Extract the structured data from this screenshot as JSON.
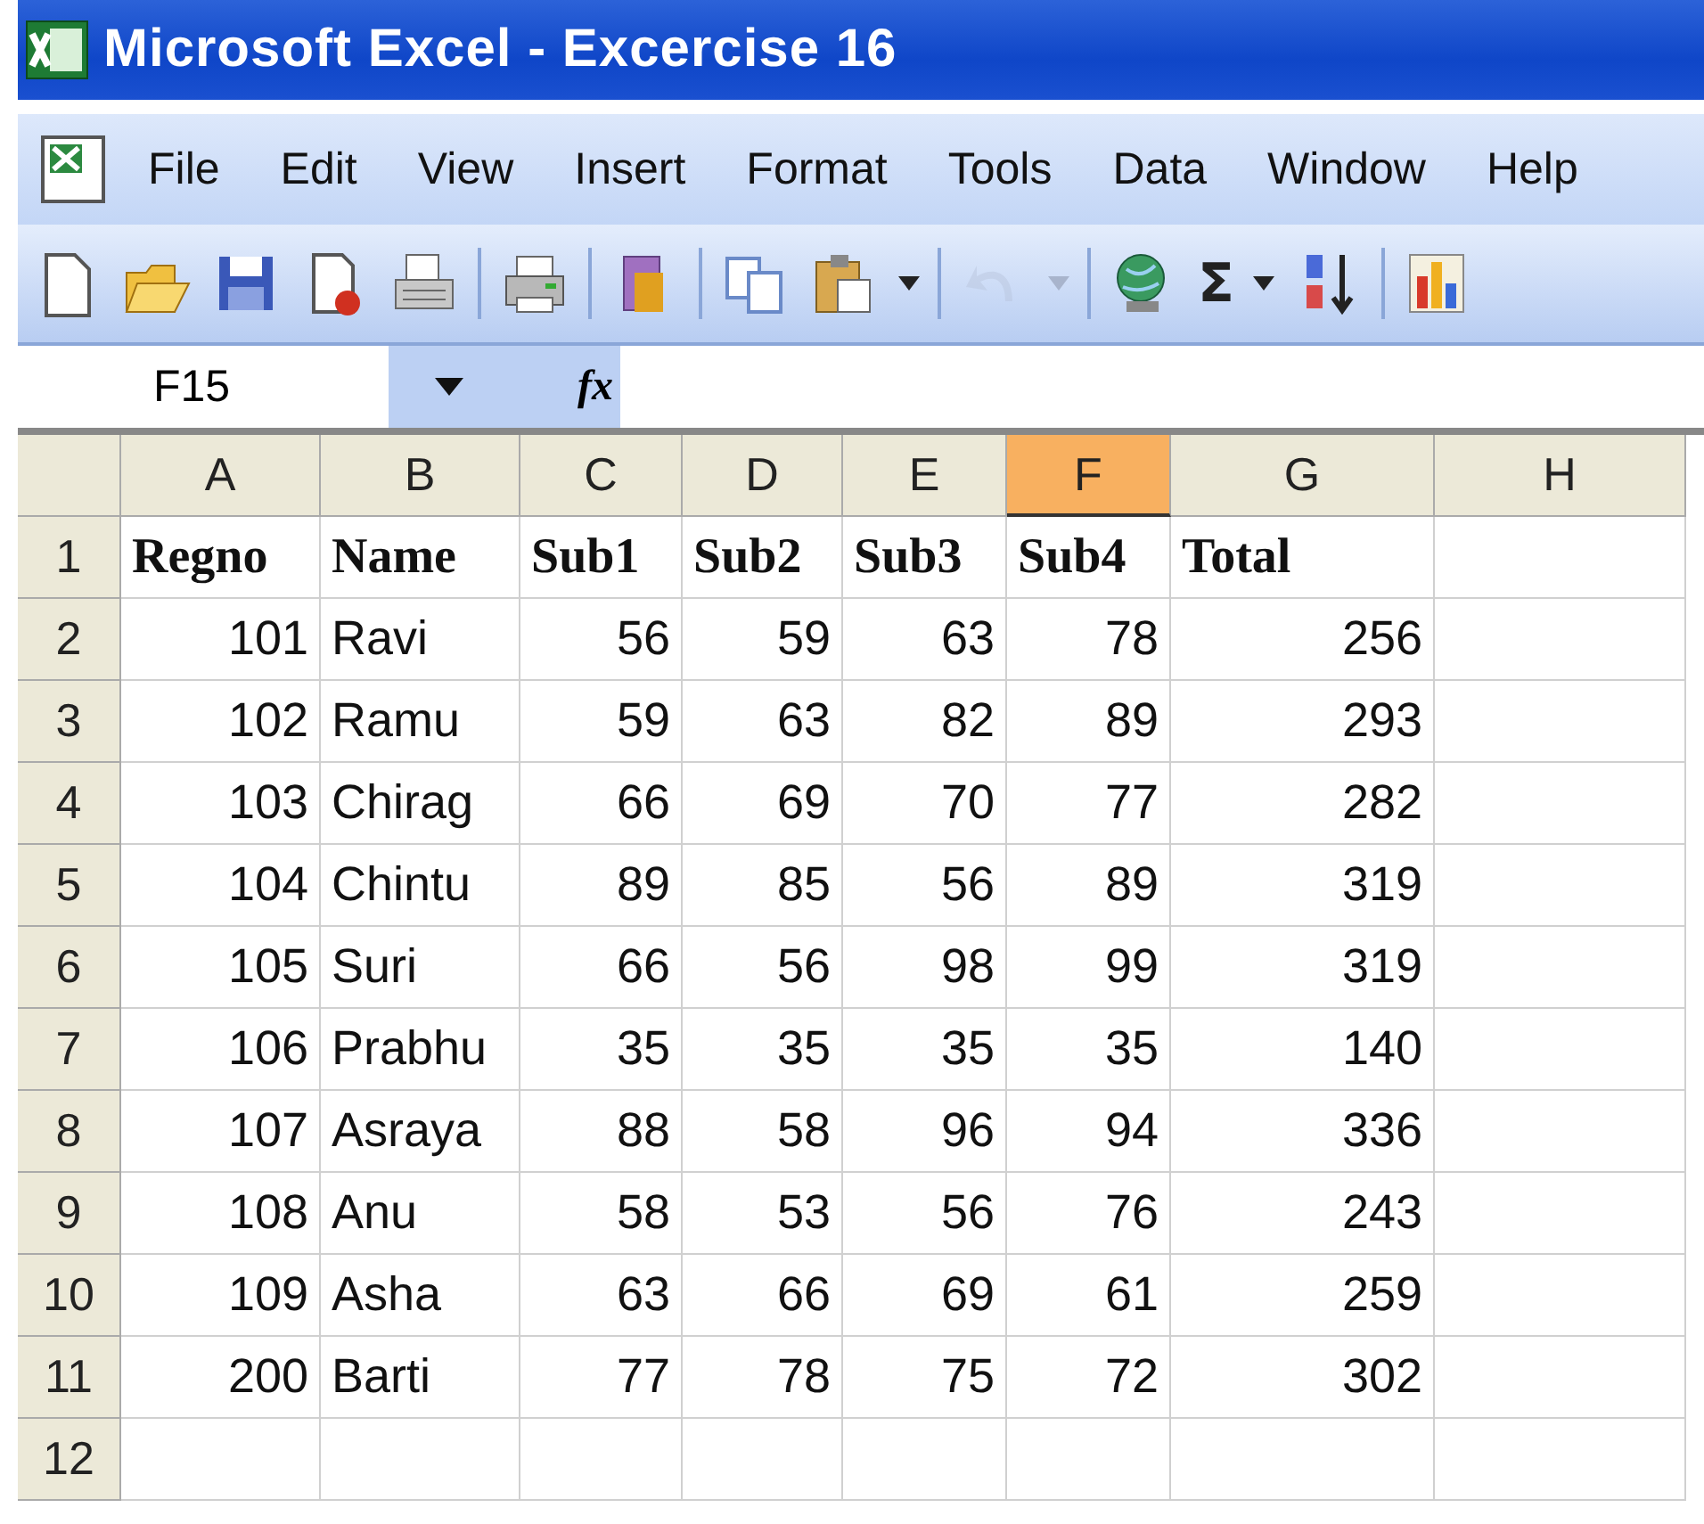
{
  "window": {
    "title": "Microsoft Excel - Excercise 16"
  },
  "menu": [
    {
      "label": "File"
    },
    {
      "label": "Edit"
    },
    {
      "label": "View"
    },
    {
      "label": "Insert"
    },
    {
      "label": "Format"
    },
    {
      "label": "Tools"
    },
    {
      "label": "Data"
    },
    {
      "label": "Window"
    },
    {
      "label": "Help"
    }
  ],
  "toolbar": [
    {
      "kind": "new",
      "disabled": false
    },
    {
      "kind": "open",
      "disabled": false
    },
    {
      "kind": "save",
      "disabled": false
    },
    {
      "kind": "permission",
      "disabled": false
    },
    {
      "kind": "email",
      "disabled": false
    },
    {
      "kind": "sep"
    },
    {
      "kind": "print",
      "disabled": false
    },
    {
      "kind": "sep"
    },
    {
      "kind": "research",
      "disabled": false
    },
    {
      "kind": "sep"
    },
    {
      "kind": "copy",
      "disabled": false
    },
    {
      "kind": "paste",
      "disabled": false
    },
    {
      "kind": "caret",
      "disabled": false
    },
    {
      "kind": "sep"
    },
    {
      "kind": "undo",
      "disabled": true
    },
    {
      "kind": "caret",
      "disabled": true
    },
    {
      "kind": "sep"
    },
    {
      "kind": "hyperlink",
      "disabled": false
    },
    {
      "kind": "sum",
      "label": "Σ",
      "disabled": false
    },
    {
      "kind": "caret",
      "disabled": false
    },
    {
      "kind": "sort",
      "disabled": false
    },
    {
      "kind": "sep"
    },
    {
      "kind": "chart",
      "disabled": false
    }
  ],
  "formula_bar": {
    "name_box": "F15",
    "function_label": "fx"
  },
  "sheet": {
    "columns": [
      {
        "label": "A",
        "selected": false
      },
      {
        "label": "B",
        "selected": false
      },
      {
        "label": "C",
        "selected": false
      },
      {
        "label": "D",
        "selected": false
      },
      {
        "label": "E",
        "selected": false
      },
      {
        "label": "F",
        "selected": true
      },
      {
        "label": "G",
        "selected": false
      },
      {
        "label": "H",
        "selected": false
      }
    ],
    "rows": [
      {
        "number": "1",
        "bold": true,
        "cells": [
          "Regno",
          "Name",
          "Sub1",
          "Sub2",
          "Sub3",
          "Sub4",
          "Total"
        ]
      },
      {
        "number": "2",
        "bold": false,
        "cells": [
          "101",
          "Ravi",
          "56",
          "59",
          "63",
          "78",
          "256"
        ]
      },
      {
        "number": "3",
        "bold": false,
        "cells": [
          "102",
          "Ramu",
          "59",
          "63",
          "82",
          "89",
          "293"
        ]
      },
      {
        "number": "4",
        "bold": false,
        "cells": [
          "103",
          "Chirag",
          "66",
          "69",
          "70",
          "77",
          "282"
        ]
      },
      {
        "number": "5",
        "bold": false,
        "cells": [
          "104",
          "Chintu",
          "89",
          "85",
          "56",
          "89",
          "319"
        ]
      },
      {
        "number": "6",
        "bold": false,
        "cells": [
          "105",
          "Suri",
          "66",
          "56",
          "98",
          "99",
          "319"
        ]
      },
      {
        "number": "7",
        "bold": false,
        "cells": [
          "106",
          "Prabhu",
          "35",
          "35",
          "35",
          "35",
          "140"
        ]
      },
      {
        "number": "8",
        "bold": false,
        "cells": [
          "107",
          "Asraya",
          "88",
          "58",
          "96",
          "94",
          "336"
        ]
      },
      {
        "number": "9",
        "bold": false,
        "cells": [
          "108",
          "Anu",
          "58",
          "53",
          "56",
          "76",
          "243"
        ]
      },
      {
        "number": "10",
        "bold": false,
        "cells": [
          "109",
          "Asha",
          "63",
          "66",
          "69",
          "61",
          "259"
        ]
      },
      {
        "number": "11",
        "bold": false,
        "cells": [
          "200",
          "Barti",
          "77",
          "78",
          "75",
          "72",
          "302"
        ]
      },
      {
        "number": "12"
      }
    ]
  }
}
